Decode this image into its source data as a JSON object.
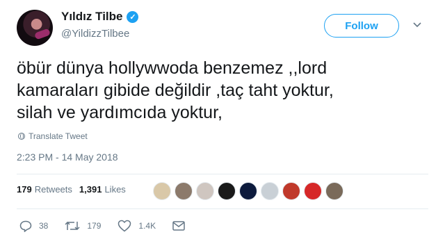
{
  "tweet": {
    "display_name": "Yıldız Tilbe",
    "handle": "@YildizzTilbee",
    "verified_icon": "verified-badge-icon",
    "follow_label": "Follow",
    "text_lines": [
      "öbür dünya hollywwoda benzemez ,,lord",
      "kamaraları gibide değildir ,taç taht yoktur,",
      "silah ve yardımcıda yoktur,"
    ],
    "translate_label": "Translate Tweet",
    "timestamp": "2:23 PM - 14 May 2018"
  },
  "stats": {
    "retweets_count": "179",
    "retweets_label": "Retweets",
    "likes_count": "1,391",
    "likes_label": "Likes"
  },
  "likers": [
    {
      "color": "#d9c8a8"
    },
    {
      "color": "#8c7a6b"
    },
    {
      "color": "#cfc6c0"
    },
    {
      "color": "#1a1a1a"
    },
    {
      "color": "#0d1b3d"
    },
    {
      "color": "#c9d0d6"
    },
    {
      "color": "#c0392b"
    },
    {
      "color": "#d62828"
    },
    {
      "color": "#7a6a5a"
    }
  ],
  "actions": {
    "replies": "38",
    "retweets": "179",
    "likes": "1.4K"
  },
  "colors": {
    "accent": "#1da1f2",
    "text": "#14171a",
    "muted": "#657786"
  }
}
